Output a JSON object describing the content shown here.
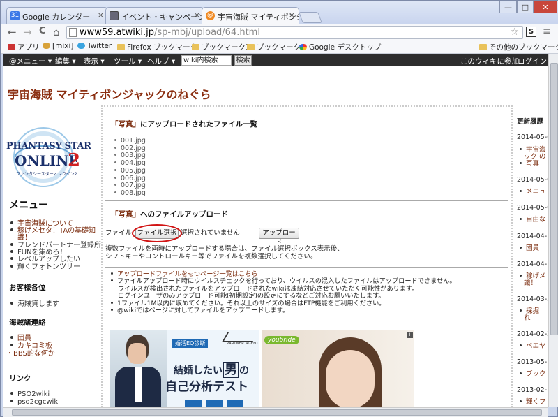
{
  "window": {
    "minimize": "—",
    "maximize": "□",
    "close": "✕"
  },
  "tabs": [
    {
      "label": "Google カレンダー",
      "icon": "calendar-icon",
      "close": "×"
    },
    {
      "label": "イベント・キャンペーン",
      "icon": "page-icon",
      "close": "×"
    },
    {
      "label": "宇宙海賊 マイティボンジ",
      "icon": "atwiki-icon",
      "close": "×"
    }
  ],
  "toolbar": {
    "back": "←",
    "forward": "→",
    "reload": "C",
    "home": "⌂",
    "url_domain": "www59.atwiki.jp",
    "url_path": "/sp-mbj/upload/64.html",
    "star": "☆",
    "menu": "≡"
  },
  "bookmarks": {
    "apps": "アプリ",
    "items": [
      "[mixi]",
      "Twitter",
      "Firefox ブックマーク",
      "ブックマーク1",
      "ブックマーク",
      "Google デスクトップ"
    ],
    "other": "その他のブックマーク"
  },
  "wikibar": {
    "menu": "@メニュー ▾",
    "edit": "編集 ▾",
    "view": "表示 ▾",
    "tool": "ツール ▾",
    "help": "ヘルプ ▾",
    "search_value": "wiki内検索",
    "search_button": "検索",
    "join": "このウィキに参加",
    "login": "ログイン"
  },
  "site": {
    "title": "宇宙海賊 マイティボンジャックのねぐら"
  },
  "logo": {
    "line1": "PHANTASY STAR",
    "line2": "ONLINE",
    "num": "2",
    "sub": "ファンタシースターオンライン2"
  },
  "sidebar": {
    "menu_title": "メニュー",
    "menu_items": [
      "宇宙海賊について",
      "稼げメセタ！TAの基礎知",
      "識！",
      "フレンドパートナー登録所",
      "FUNを集めろ！",
      "レベルアップしたい",
      "輝くフォトンツリー"
    ],
    "customers_title": "お客様各位",
    "customers_items": [
      "海賊貸します"
    ],
    "contact_title": "海賊諸連絡",
    "contact_items": [
      "団員",
      "カキコミ板",
      "・BBS的な何か"
    ],
    "link_title": "リンク",
    "link_items": [
      "PSO2wiki",
      "pso2cgcwiki"
    ]
  },
  "main": {
    "list_title_q": "「写真」",
    "list_title_rest": "にアップロードされたファイル一覧",
    "files": [
      "001.jpg",
      "002.jpg",
      "003.jpg",
      "004.jpg",
      "005.jpg",
      "006.jpg",
      "007.jpg",
      "008.jpg"
    ],
    "upload_title_q": "「写真」",
    "upload_title_rest": "へのファイルアップロード",
    "file_label": "ファイル",
    "choose_button": "ファイル選択",
    "no_file": "選択されていません",
    "upload_button": "アップロード",
    "note1": "複数ファイルを両時にアップロードする場合は、ファイル選択ボックス表示後、",
    "note2": "シフトキーやコントロールキー等でファイルを複数選択してください。",
    "bullet_link": "アップロードファイルをもつページ一覧はこちら",
    "bullets": [
      "ファイルアップロード時にウイルスチェックを行っており、ウイルスの混入したファイルはアップロードできません。",
      "ウイルスが検出されたファイルをアップロードされたwikiは凍結対応させていただく可能性があります。",
      "ログインユーザのみアップロード可能(初期設定)の設定にするなどご対応お願いいたします。",
      "1ファイル1M以内に収めてください。それ以上のサイズの場合はFTP機能をご利用ください。",
      "@wikiではページに対してファイルをアップロードします。"
    ]
  },
  "ads": {
    "ad1_badge": "婚活EQ診断",
    "ad1_brand": "PARTNER AGENT",
    "ad1_line1_a": "結婚したい",
    "ad1_line1_b": "男",
    "ad1_line1_c": "の",
    "ad1_line2": "自己分析テスト",
    "ad2_brand": "youbride",
    "ad2_close": "i"
  },
  "rightbar": {
    "title": "更新履歴",
    "entries": [
      {
        "date": "2014-05-0",
        "items": [
          "宇宙海",
          "ック の",
          "写真"
        ]
      },
      {
        "date": "2014-05-0",
        "items": [
          "メニュ"
        ]
      },
      {
        "date": "2014-05-0",
        "items": [
          "自由な"
        ]
      },
      {
        "date": "2014-04-1",
        "items": [
          "団員"
        ]
      },
      {
        "date": "2014-04-1",
        "items": [
          "稼げメ",
          "識！"
        ]
      },
      {
        "date": "2014-03-3",
        "items": [
          "採掘",
          "れ"
        ]
      },
      {
        "date": "2014-02-2",
        "items": [
          "ペエヤ"
        ]
      },
      {
        "date": "2013-05-1",
        "items": [
          "ブック"
        ]
      },
      {
        "date": "2013-02-1",
        "items": [
          "輝くフ"
        ]
      }
    ]
  },
  "colors": {
    "accent": "#7b2c0e",
    "title": "#8b2e10",
    "wikibar": "#2d2d2d",
    "highlight": "#d11414"
  }
}
